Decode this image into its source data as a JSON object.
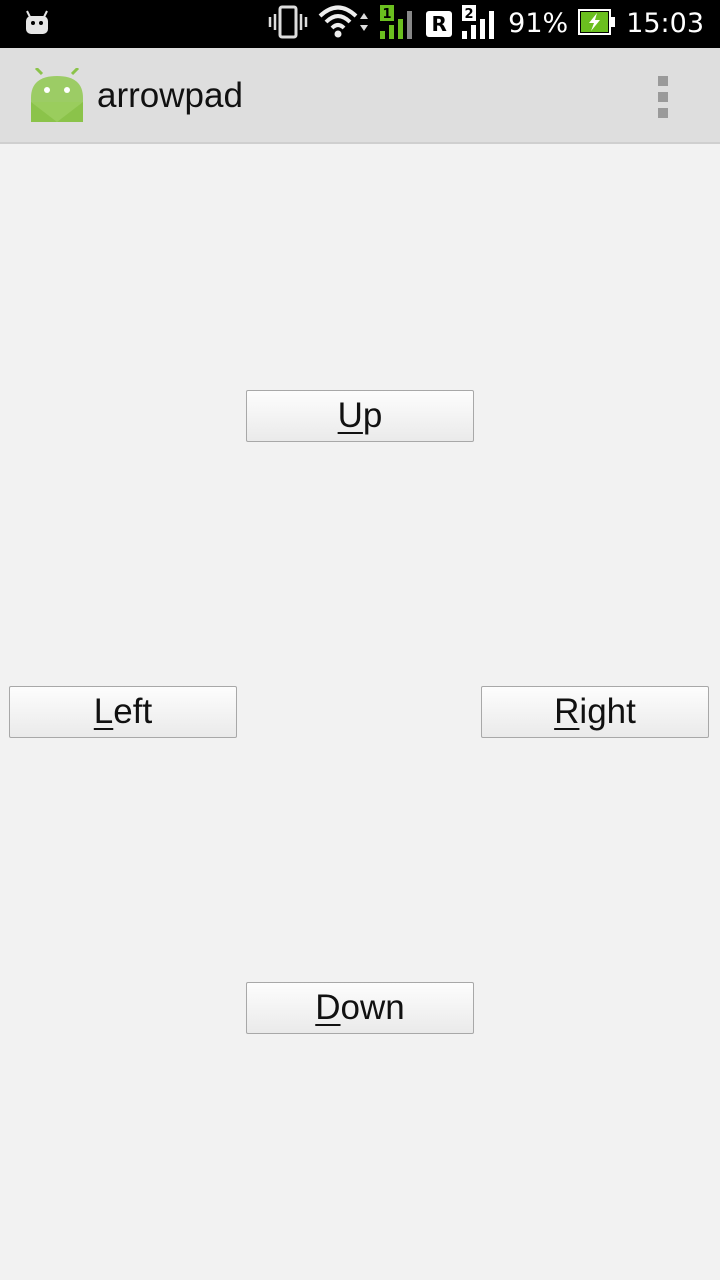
{
  "status_bar": {
    "battery_percent": "91%",
    "time": "15:03",
    "sim1_label": "1",
    "sim2_label": "2",
    "roaming_label": "R",
    "icons": [
      "android-debug-icon",
      "vibrate-icon",
      "wifi-icon",
      "signal-icon",
      "battery-charging-icon"
    ],
    "accent": "#6bbf1f"
  },
  "action_bar": {
    "title": "arrowpad",
    "icon": "android-app-icon",
    "menu_icon": "overflow-menu-icon",
    "background": "#dedede"
  },
  "buttons": {
    "up": {
      "mnemonic": "U",
      "rest": "p"
    },
    "left": {
      "mnemonic": "L",
      "rest": "eft"
    },
    "right": {
      "mnemonic": "R",
      "rest": "ight"
    },
    "down": {
      "mnemonic": "D",
      "rest": "own"
    }
  }
}
